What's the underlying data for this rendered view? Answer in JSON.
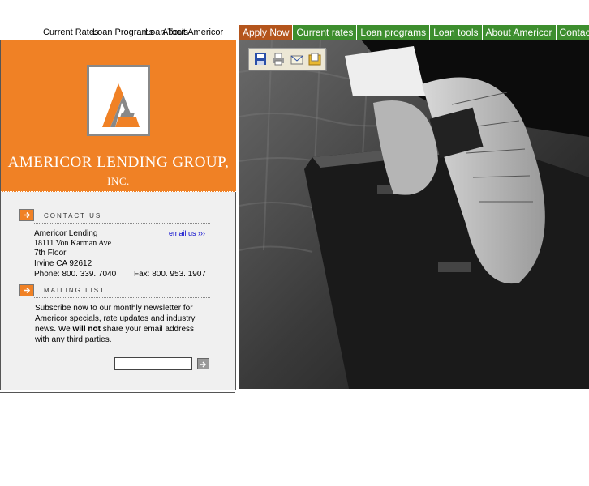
{
  "top_links": [
    "Current Rates",
    "Loan Programs",
    "Loan Tools",
    "About Americor"
  ],
  "nav": {
    "tabs": [
      "Apply Now",
      "Current rates",
      "Loan programs",
      "Loan tools",
      "About Americor",
      "Contact us"
    ]
  },
  "company": {
    "name": "AMERICOR LENDING GROUP,",
    "suffix": "INC."
  },
  "contact": {
    "heading": "CONTACT US",
    "email_link": "email us ›››",
    "name": "Americor Lending",
    "street": "18111 Von Karman Ave",
    "floor": "7th Floor",
    "city": "Irvine CA 92612",
    "phone": "Phone: 800. 339. 7040",
    "fax": "Fax: 800. 953. 1907"
  },
  "mailing": {
    "heading": "MAILING LIST",
    "text_before": "Subscribe now to our monthly newsletter for Americor specials, rate updates and industry news. We ",
    "text_bold": "will not",
    "text_after": " share your email address with any third parties.",
    "input_value": ""
  },
  "toolbar": [
    "save-icon",
    "print-icon",
    "email-icon",
    "bookmark-icon"
  ],
  "colors": {
    "orange": "#f08125",
    "green": "#3d8e2e",
    "apply": "#b4551c"
  }
}
